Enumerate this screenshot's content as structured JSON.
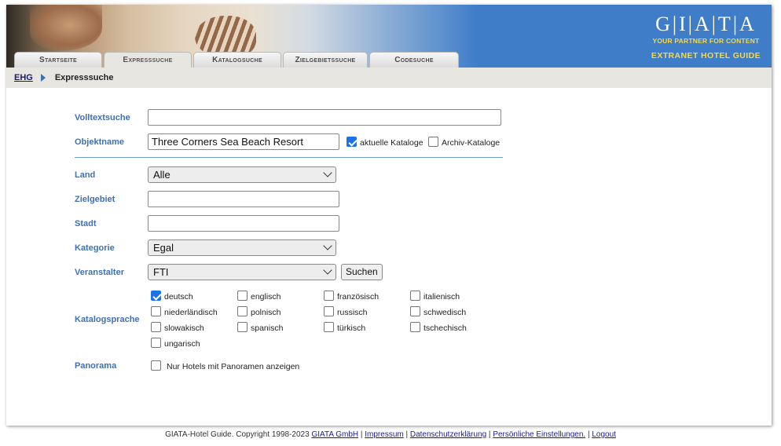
{
  "logo": {
    "letters": "G|I|A|T|A",
    "tagline": "YOUR PARTNER FOR CONTENT",
    "guide": "EXTRANET HOTEL GUIDE"
  },
  "tabs": [
    {
      "label": "Startseite",
      "active": false
    },
    {
      "label": "Expresssuche",
      "active": true
    },
    {
      "label": "Katalogsuche",
      "active": false
    },
    {
      "label": "Zielgebietssuche",
      "active": false
    },
    {
      "label": "Codesuche",
      "active": false
    }
  ],
  "breadcrumb": {
    "root": "EHG",
    "current": "Expresssuche"
  },
  "form": {
    "volltext": {
      "label": "Volltextsuche",
      "value": ""
    },
    "objekt": {
      "label": "Objektname",
      "value": "Three Corners Sea Beach Resort"
    },
    "aktuelle": {
      "label": "aktuelle Kataloge",
      "checked": true
    },
    "archiv": {
      "label": "Archiv-Kataloge",
      "checked": false
    },
    "land": {
      "label": "Land",
      "value": "Alle"
    },
    "zielgebiet": {
      "label": "Zielgebiet",
      "value": ""
    },
    "stadt": {
      "label": "Stadt",
      "value": ""
    },
    "kategorie": {
      "label": "Kategorie",
      "value": "Egal"
    },
    "veranstalter": {
      "label": "Veranstalter",
      "value": "FTI"
    },
    "suchen": "Suchen",
    "katalogsprache": {
      "label": "Katalogsprache"
    },
    "languages": [
      {
        "label": "deutsch",
        "checked": true
      },
      {
        "label": "englisch",
        "checked": false
      },
      {
        "label": "französisch",
        "checked": false
      },
      {
        "label": "italienisch",
        "checked": false
      },
      {
        "label": "niederländisch",
        "checked": false
      },
      {
        "label": "polnisch",
        "checked": false
      },
      {
        "label": "russisch",
        "checked": false
      },
      {
        "label": "schwedisch",
        "checked": false
      },
      {
        "label": "slowakisch",
        "checked": false
      },
      {
        "label": "spanisch",
        "checked": false
      },
      {
        "label": "türkisch",
        "checked": false
      },
      {
        "label": "tschechisch",
        "checked": false
      },
      {
        "label": "ungarisch",
        "checked": false
      }
    ],
    "panorama": {
      "label": "Panorama",
      "option": "Nur Hotels mit Panoramen anzeigen",
      "checked": false
    }
  },
  "footer": {
    "copyright": "GIATA-Hotel Guide. Copyright 1998-2023",
    "links": [
      "GIATA GmbH",
      "Impressum",
      "Datenschutzerklärung",
      "Persönliche Einstellungen.",
      "Logout"
    ]
  },
  "colors": {
    "header": "#3f7dc9",
    "label": "#3f70b4",
    "gold": "#f5d84a",
    "checkbox": "#1a73e8"
  }
}
